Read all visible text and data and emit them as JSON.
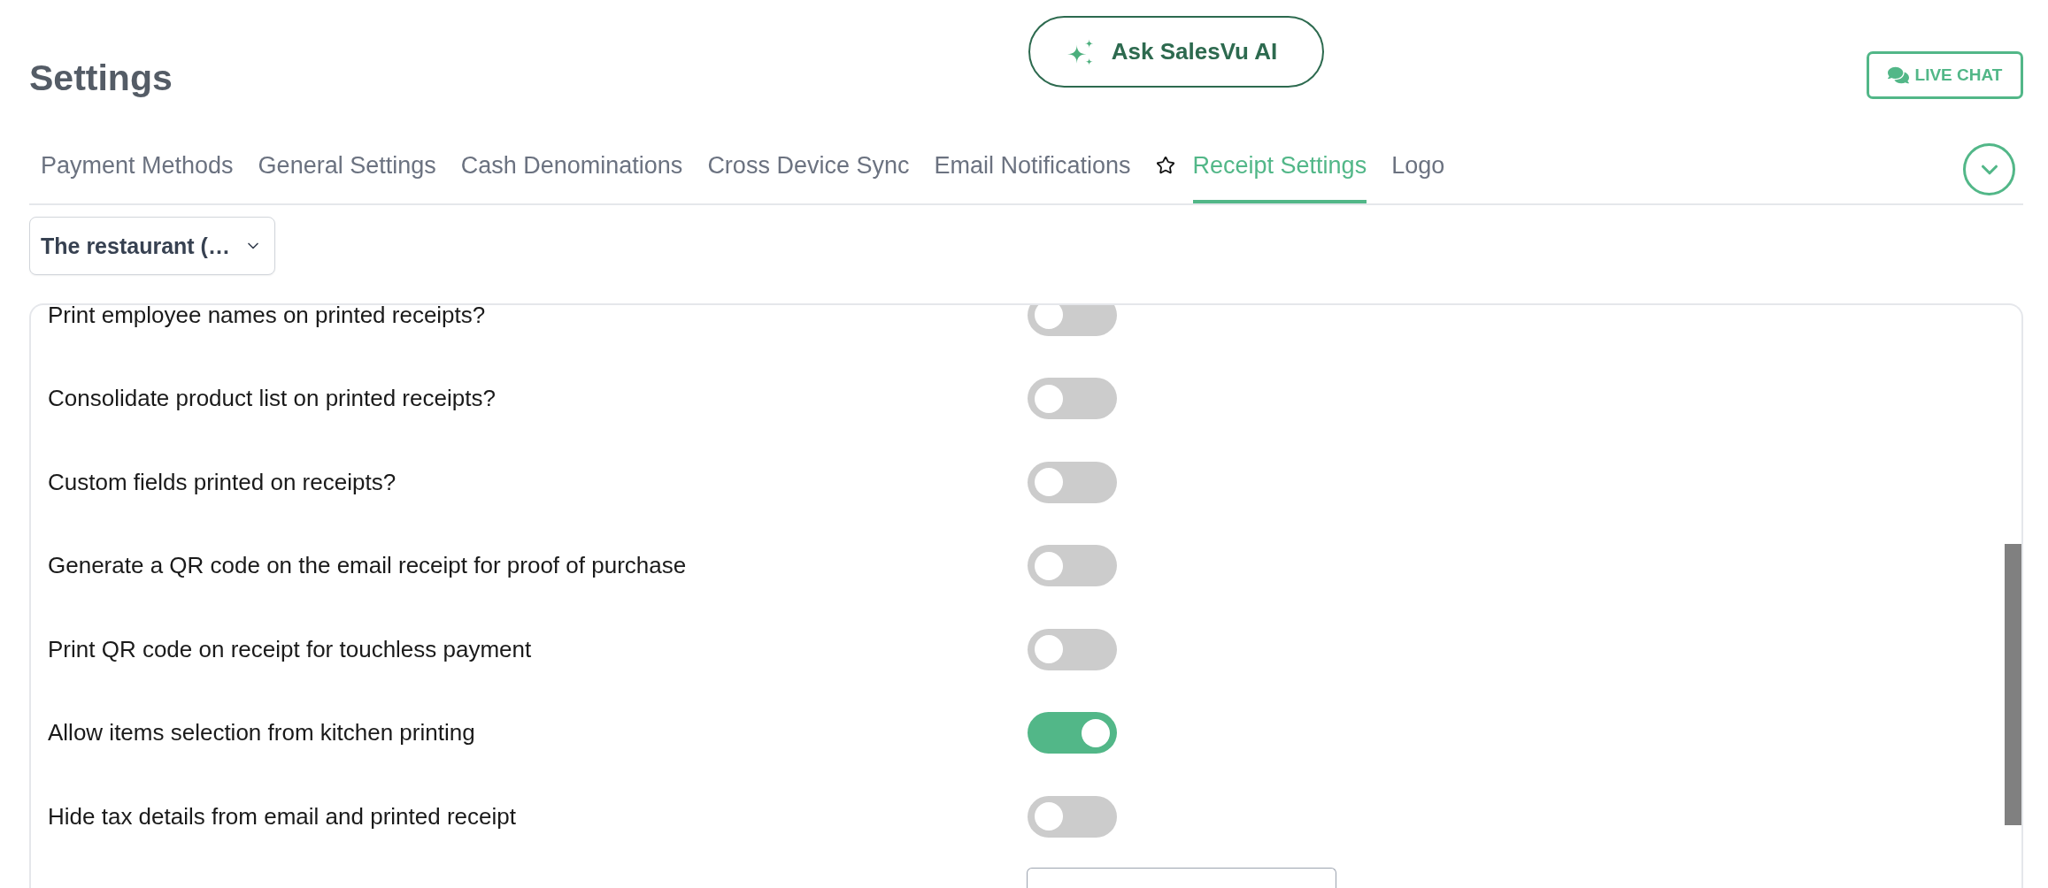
{
  "page": {
    "title": "Settings"
  },
  "header": {
    "ai_button": {
      "label": "Ask SalesVu AI"
    },
    "chat_button": {
      "label": "LIVE CHAT"
    }
  },
  "tabs": [
    {
      "label": "Payment Methods",
      "selected": false,
      "favorite": false
    },
    {
      "label": "General Settings",
      "selected": false,
      "favorite": false
    },
    {
      "label": "Cash Denominations",
      "selected": false,
      "favorite": false
    },
    {
      "label": "Cross Device Sync",
      "selected": false,
      "favorite": false
    },
    {
      "label": "Email Notifications",
      "selected": false,
      "favorite": false
    },
    {
      "label": "Receipt Settings",
      "selected": true,
      "favorite": true
    },
    {
      "label": "Logo",
      "selected": false,
      "favorite": false
    }
  ],
  "location_select": {
    "value": "The restaurant (…"
  },
  "settings": [
    {
      "kind": "toggle",
      "label": "Print employee names on printed receipts?",
      "on": false
    },
    {
      "kind": "toggle",
      "label": "Consolidate product list on printed receipts?",
      "on": false
    },
    {
      "kind": "toggle",
      "label": "Custom fields printed on receipts?",
      "on": false
    },
    {
      "kind": "toggle",
      "label": "Generate a QR code on the email receipt for proof of purchase",
      "on": false
    },
    {
      "kind": "toggle",
      "label": "Print QR code on receipt for touchless payment",
      "on": false
    },
    {
      "kind": "toggle",
      "label": "Allow items selection from kitchen printing",
      "on": true
    },
    {
      "kind": "toggle",
      "label": "Hide tax details from email and printed receipt",
      "on": false
    },
    {
      "kind": "input"
    }
  ]
}
